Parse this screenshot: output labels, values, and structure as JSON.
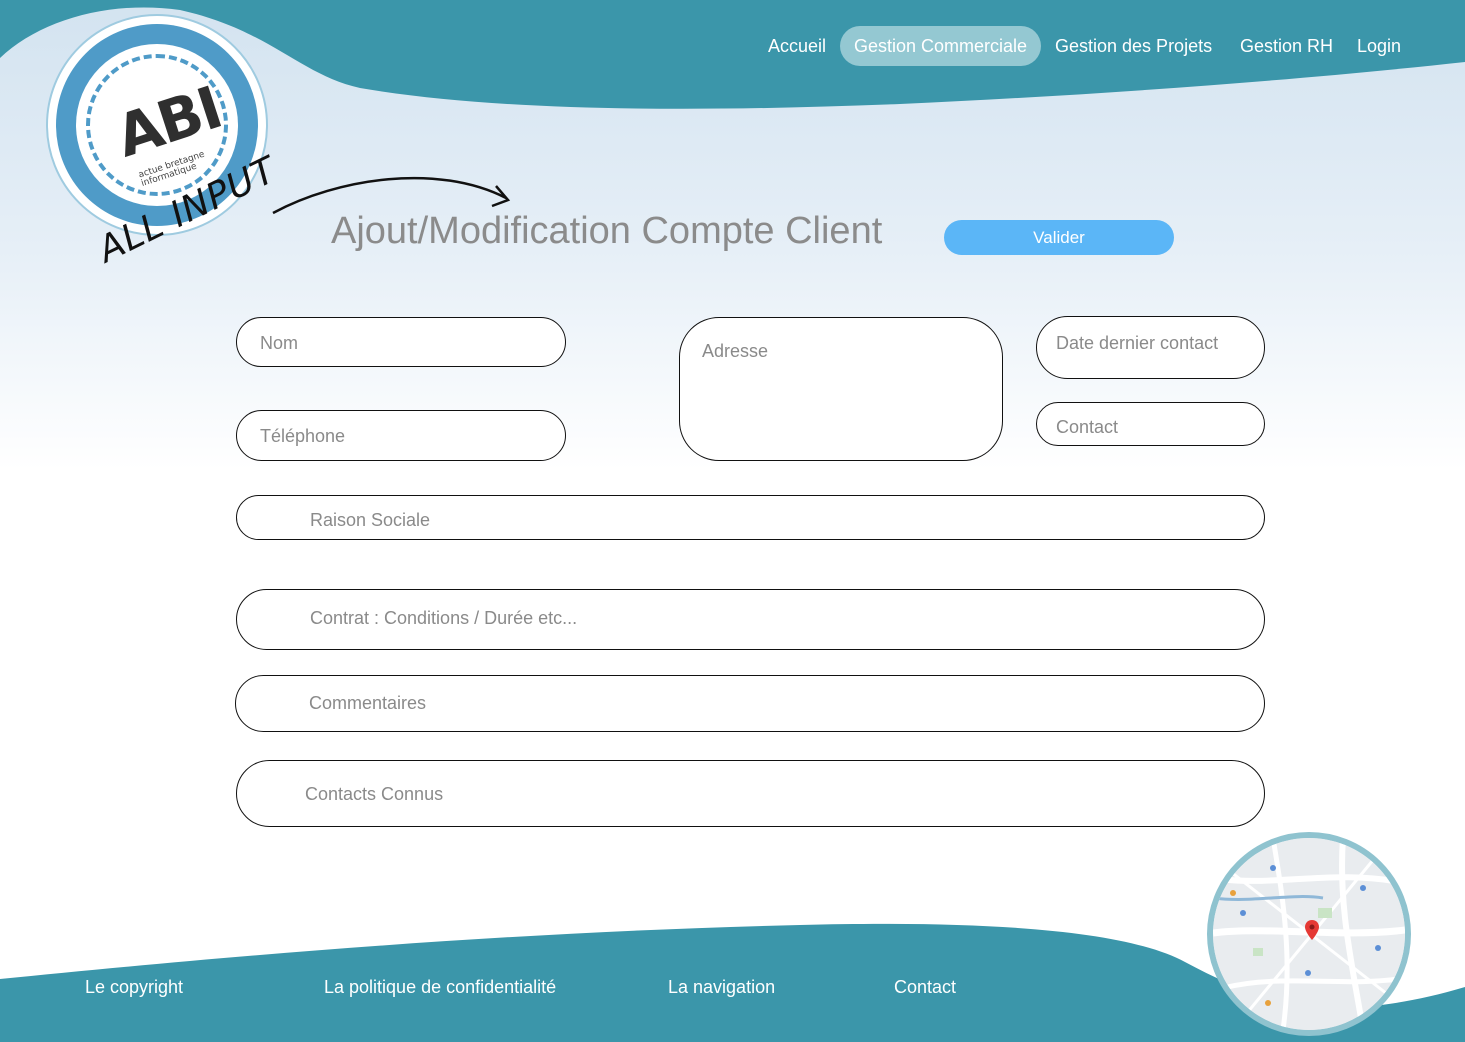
{
  "nav": {
    "items": [
      {
        "label": "Accueil",
        "active": false
      },
      {
        "label": "Gestion Commerciale",
        "active": true
      },
      {
        "label": "Gestion des Projets",
        "active": false
      },
      {
        "label": "Gestion RH",
        "active": false
      },
      {
        "label": "Login",
        "active": false
      }
    ]
  },
  "logo": {
    "text": "ABI",
    "subtitle": "actue bretagne informatique"
  },
  "annotation": {
    "text": "ALL INPUT"
  },
  "page": {
    "title": "Ajout/Modification Compte Client",
    "submit_label": "Valider"
  },
  "form": {
    "nom": {
      "placeholder": "Nom"
    },
    "telephone": {
      "placeholder": "Téléphone"
    },
    "adresse": {
      "placeholder": "Adresse"
    },
    "date_dernier_contact": {
      "placeholder": "Date dernier contact"
    },
    "contact": {
      "placeholder": "Contact"
    },
    "raison_sociale": {
      "placeholder": "Raison Sociale"
    },
    "contrat": {
      "placeholder": "Contrat : Conditions / Durée etc..."
    },
    "commentaires": {
      "placeholder": "Commentaires"
    },
    "contacts_connus": {
      "placeholder": "Contacts Connus"
    }
  },
  "footer": {
    "links": [
      "Le copyright",
      "La politique de confidentialité",
      "La navigation",
      "Contact"
    ]
  },
  "colors": {
    "brand": "#3b96aa",
    "button": "#5bb6f7",
    "nav_active": "#94c8d2",
    "placeholder": "#8a8a8a"
  }
}
